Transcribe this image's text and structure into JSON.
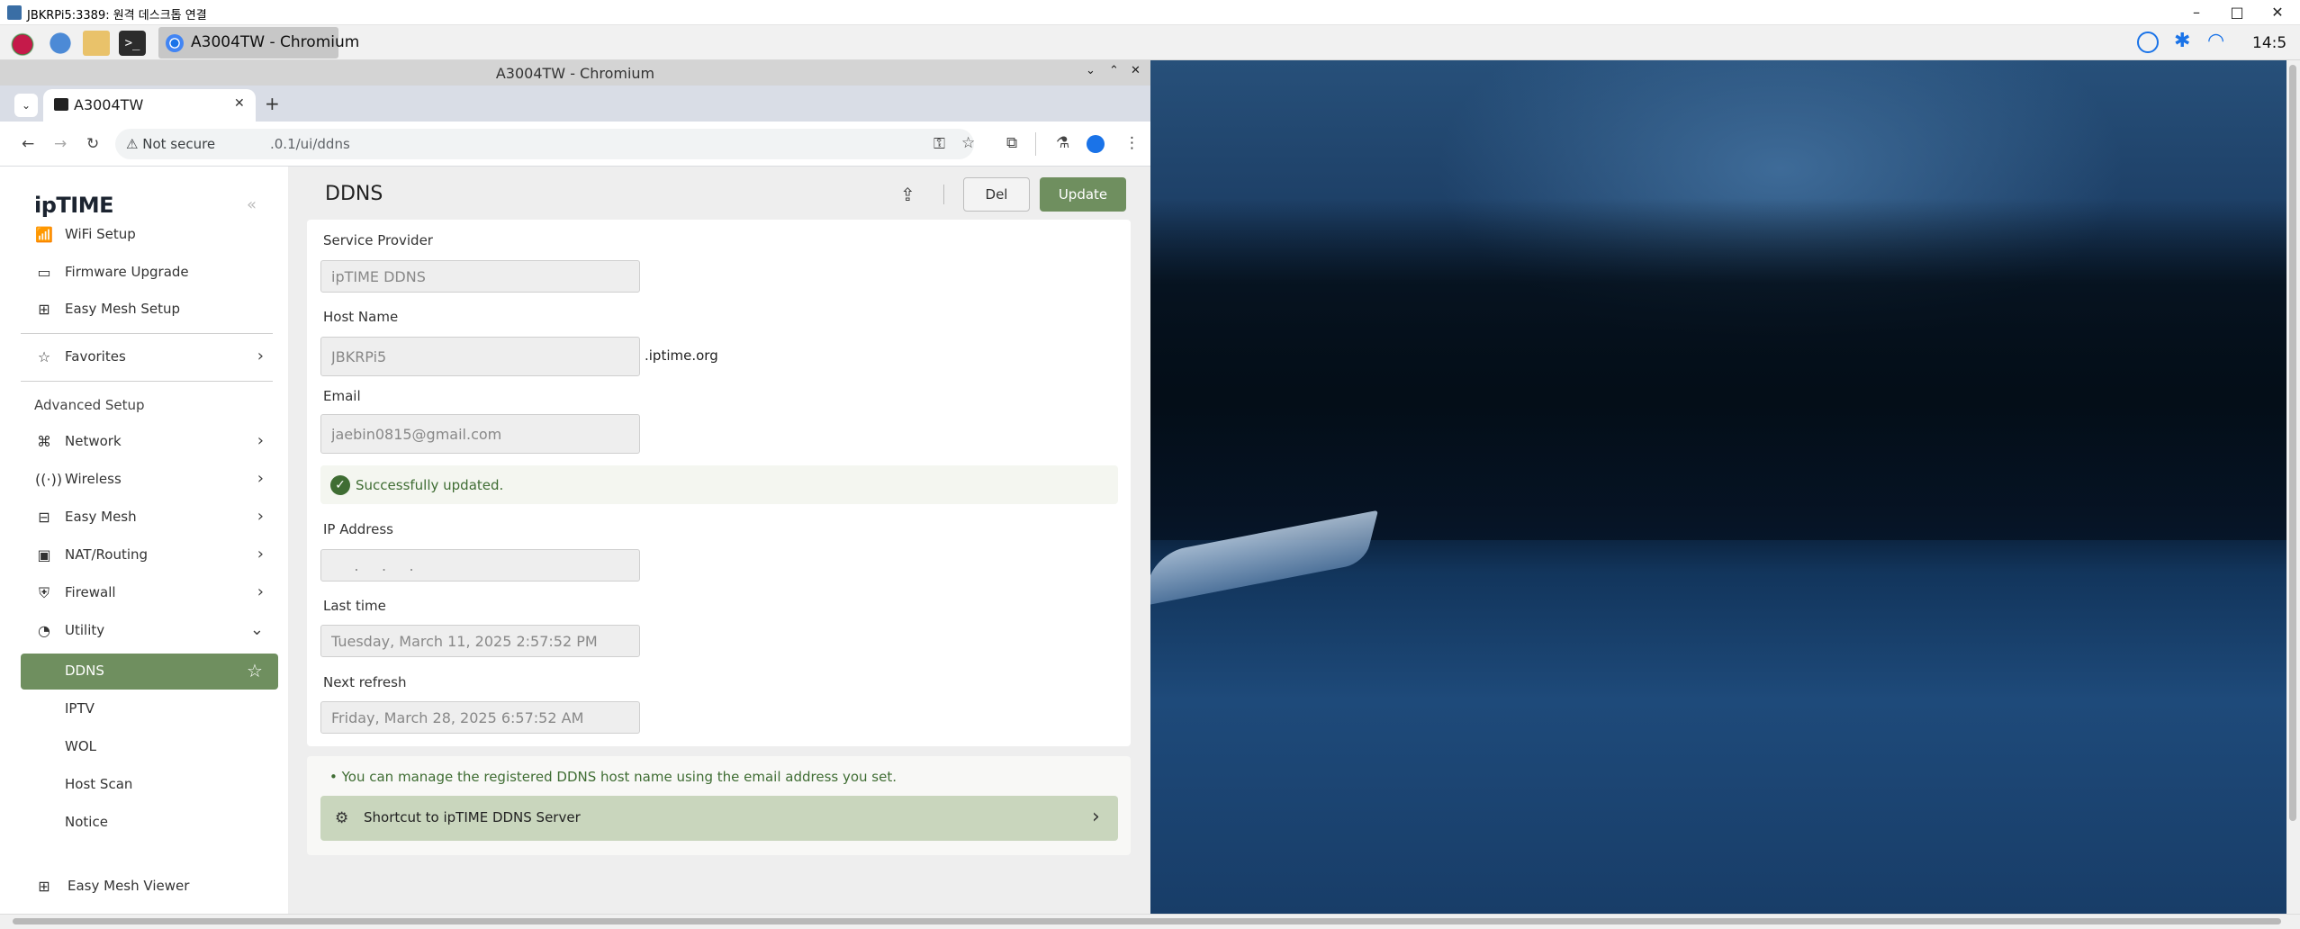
{
  "rdp": {
    "title": "JBKRPi5:3389: 원격 데스크톱 연결"
  },
  "taskbar": {
    "chromium_label": "A3004TW - Chromium",
    "clock": "14:5"
  },
  "chromium": {
    "window_title": "A3004TW - Chromium",
    "tab_title": "A3004TW",
    "not_secure": "Not secure",
    "url": ".0.1/ui/ddns"
  },
  "sidebar": {
    "logo": "ipTIME",
    "items": [
      {
        "label": "WiFi Setup"
      },
      {
        "label": "Firmware Upgrade"
      },
      {
        "label": "Easy Mesh Setup"
      },
      {
        "label": "Favorites"
      }
    ],
    "section_advanced": "Advanced Setup",
    "advanced": [
      {
        "label": "Network"
      },
      {
        "label": "Wireless"
      },
      {
        "label": "Easy Mesh"
      },
      {
        "label": "NAT/Routing"
      },
      {
        "label": "Firewall"
      },
      {
        "label": "Utility"
      }
    ],
    "utility_sub": [
      {
        "label": "DDNS"
      },
      {
        "label": "IPTV"
      },
      {
        "label": "WOL"
      },
      {
        "label": "Host Scan"
      },
      {
        "label": "Notice"
      }
    ],
    "bottom": {
      "label": "Easy Mesh Viewer"
    }
  },
  "main": {
    "title": "DDNS",
    "del_label": "Del",
    "update_label": "Update",
    "fields": {
      "service_provider": {
        "label": "Service Provider",
        "value": "ipTIME DDNS"
      },
      "host_name": {
        "label": "Host Name",
        "value": "JBKRPi5",
        "suffix": ".iptime.org"
      },
      "email": {
        "label": "Email",
        "value": "jaebin0815@gmail.com"
      },
      "ip_address": {
        "label": "IP Address",
        "value": "     .     .     ."
      },
      "last_time": {
        "label": "Last time",
        "value": "Tuesday, March 11, 2025 2:57:52 PM"
      },
      "next_refresh": {
        "label": "Next refresh",
        "value": "Friday, March 28, 2025 6:57:52 AM"
      }
    },
    "success": "Successfully updated.",
    "note": "• You can manage the registered DDNS host name using the email address you set.",
    "shortcut": "Shortcut to ipTIME DDNS Server"
  },
  "colors": {
    "accent": "#6f8f5f",
    "success": "#3f6d33",
    "shortcut_bg": "#c9d6bd"
  }
}
